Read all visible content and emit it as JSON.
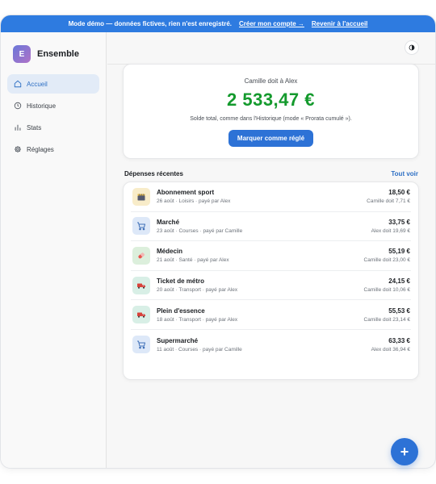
{
  "banner": {
    "text": "Mode démo — données fictives, rien n'est enregistré.",
    "create_account": "Créer mon compte →",
    "back_home": "Revenir à l'accueil"
  },
  "brand": {
    "logo_letter": "E",
    "name": "Ensemble"
  },
  "nav": {
    "items": [
      {
        "label": "Accueil",
        "icon": "home-icon",
        "active": true
      },
      {
        "label": "Historique",
        "icon": "clock-icon",
        "active": false
      },
      {
        "label": "Stats",
        "icon": "bar-chart-icon",
        "active": false
      },
      {
        "label": "Réglages",
        "icon": "gear-icon",
        "active": false
      }
    ]
  },
  "topbar": {
    "theme_toggle_icon": "contrast-icon"
  },
  "balance": {
    "owe_text": "Camille doit à Alex",
    "amount": "2 533,47 €",
    "note": "Solde total, comme dans l'Historique (mode « Prorata cumulé »).",
    "settle_button": "Marquer comme réglé"
  },
  "recent": {
    "title": "Dépenses récentes",
    "see_all": "Tout voir",
    "items": [
      {
        "name": "Abonnement sport",
        "meta": "26 août · Loisirs · payé par Alex",
        "amount": "18,50 €",
        "share": "Camille doit 7,71 €",
        "icon": "clapperboard-icon",
        "icon_bg": "#f8ecc9"
      },
      {
        "name": "Marché",
        "meta": "23 août · Courses · payé par Camille",
        "amount": "33,75 €",
        "share": "Alex doit 19,69 €",
        "icon": "cart-icon",
        "icon_bg": "#dde8f8"
      },
      {
        "name": "Médecin",
        "meta": "21 août · Santé · payé par Alex",
        "amount": "55,19 €",
        "share": "Camille doit 23,00 €",
        "icon": "pill-icon",
        "icon_bg": "#dcefdc"
      },
      {
        "name": "Ticket de métro",
        "meta": "20 août · Transport · payé par Alex",
        "amount": "24,15 €",
        "share": "Camille doit 10,06 €",
        "icon": "truck-icon",
        "icon_bg": "#d8efe6"
      },
      {
        "name": "Plein d'essence",
        "meta": "18 août · Transport · payé par Alex",
        "amount": "55,53 €",
        "share": "Camille doit 23,14 €",
        "icon": "truck-icon",
        "icon_bg": "#d8efe6"
      },
      {
        "name": "Supermarché",
        "meta": "11 août · Courses · payé par Camille",
        "amount": "63,33 €",
        "share": "Alex doit 36,94 €",
        "icon": "cart-icon",
        "icon_bg": "#dde8f8"
      }
    ]
  },
  "fab": {
    "label": "+",
    "icon": "plus-icon"
  },
  "colors": {
    "accent": "#2d72d6",
    "balance_green": "#149a2d",
    "banner": "#2e7be0"
  }
}
